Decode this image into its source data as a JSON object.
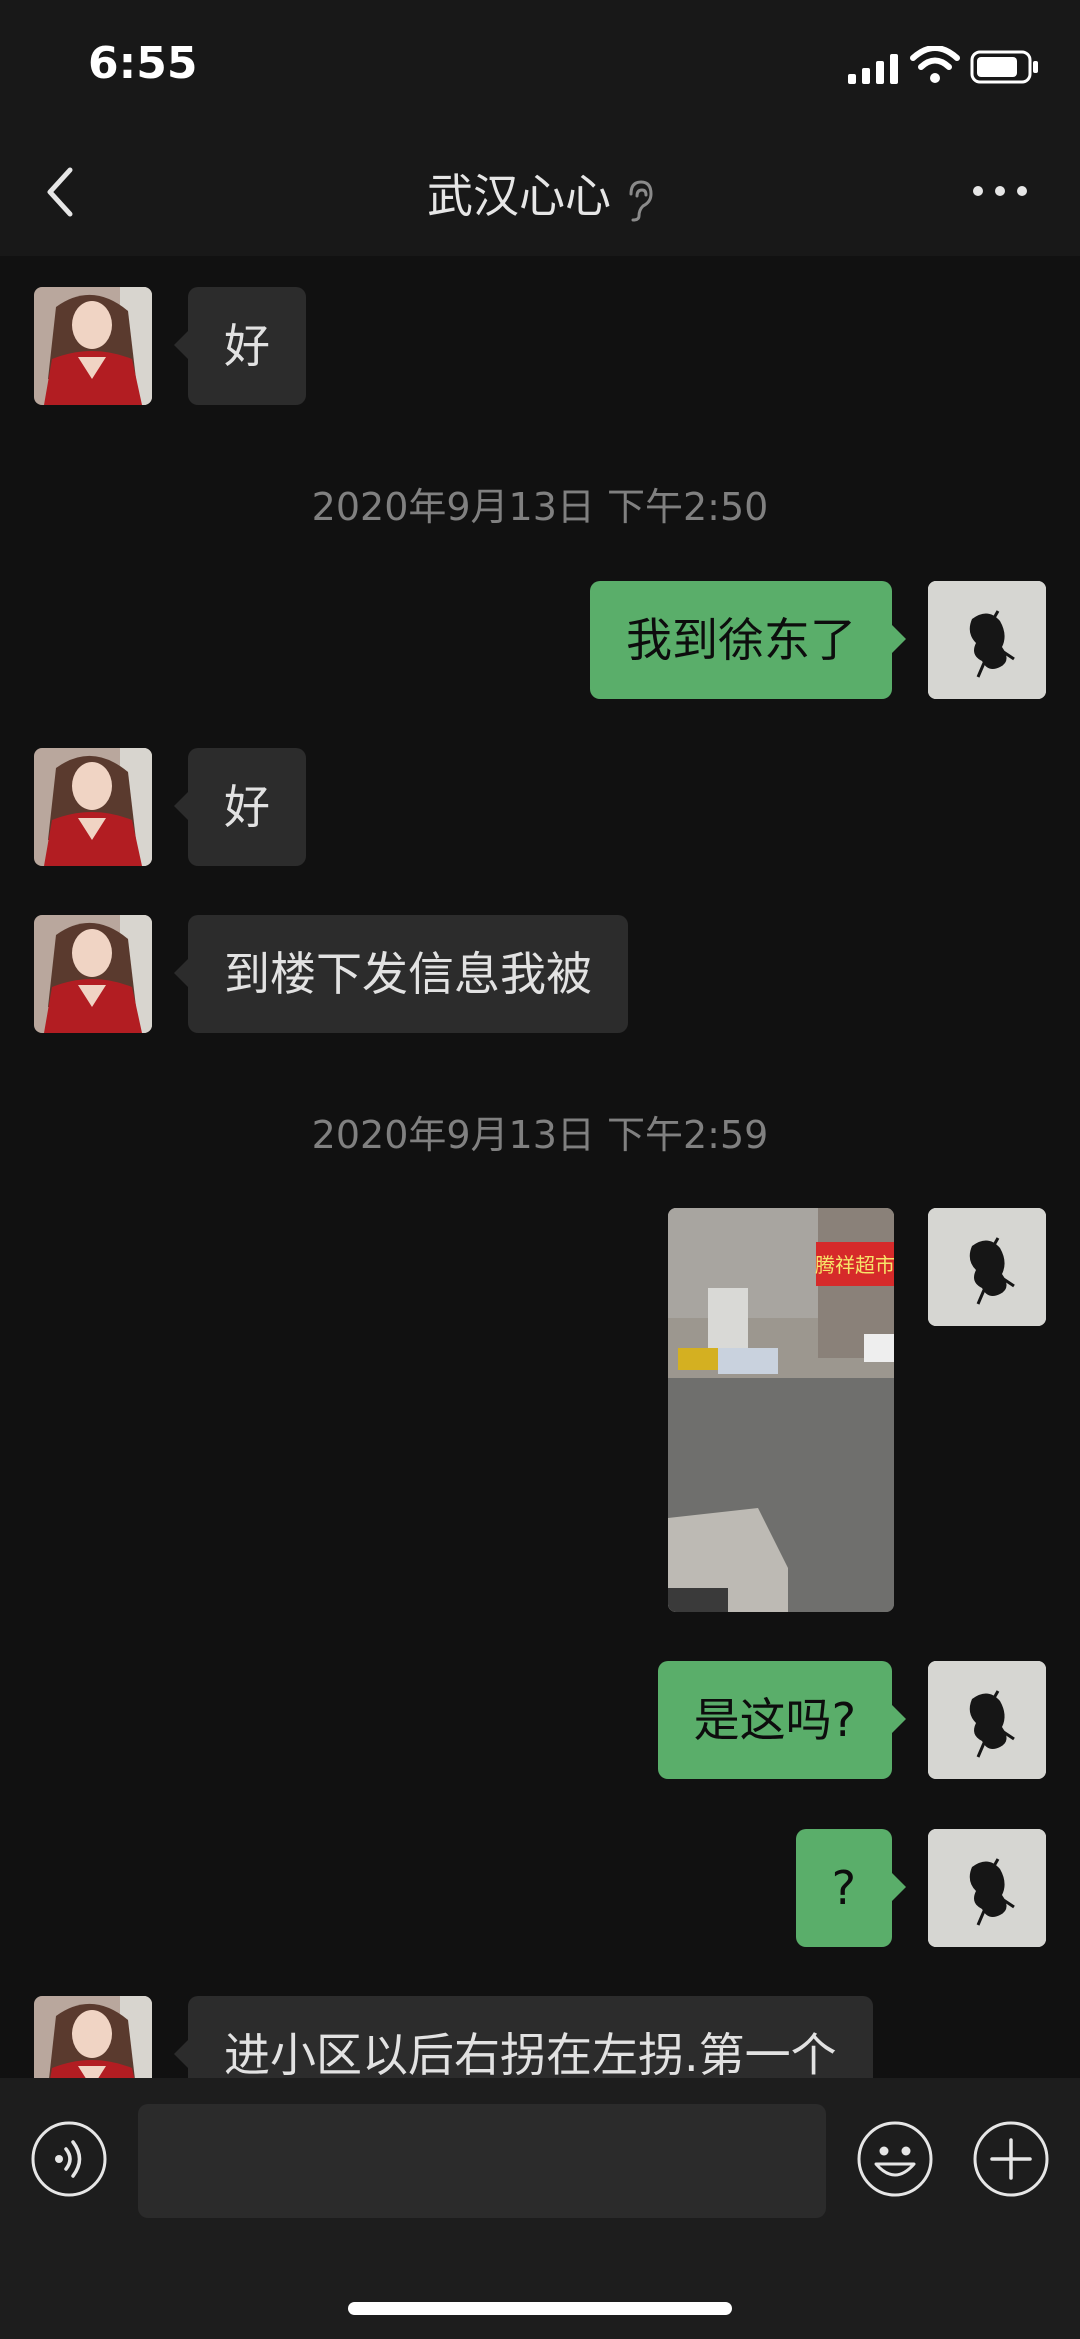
{
  "status_bar": {
    "time": "6:55"
  },
  "nav": {
    "title": "武汉心心",
    "back_icon": "chevron-left-icon",
    "ear_icon": "ear-icon",
    "more_icon": "more-dots-icon"
  },
  "messages": [
    {
      "type": "text",
      "side": "in",
      "text": "好"
    },
    {
      "type": "timestamp",
      "text": "2020年9月13日 下午2:50"
    },
    {
      "type": "text",
      "side": "out",
      "text": "我到徐东了"
    },
    {
      "type": "text",
      "side": "in",
      "text": "好"
    },
    {
      "type": "text",
      "side": "in",
      "text": "到楼下发信息我被"
    },
    {
      "type": "timestamp",
      "text": "2020年9月13日 下午2:59"
    },
    {
      "type": "image",
      "side": "out",
      "sign_text": "腾祥超市"
    },
    {
      "type": "text",
      "side": "out",
      "text": "是这吗?"
    },
    {
      "type": "text",
      "side": "out",
      "text": "?"
    },
    {
      "type": "text",
      "side": "in",
      "text": "进小区以后右拐在左拐.第一个"
    }
  ],
  "input_bar": {
    "value": "",
    "voice_icon": "voice-icon",
    "emoji_icon": "emoji-icon",
    "plus_icon": "plus-icon"
  },
  "colors": {
    "background": "#111111",
    "out_bubble": "#5aae6a",
    "in_bubble": "#2c2c2c",
    "bar": "#181818"
  }
}
